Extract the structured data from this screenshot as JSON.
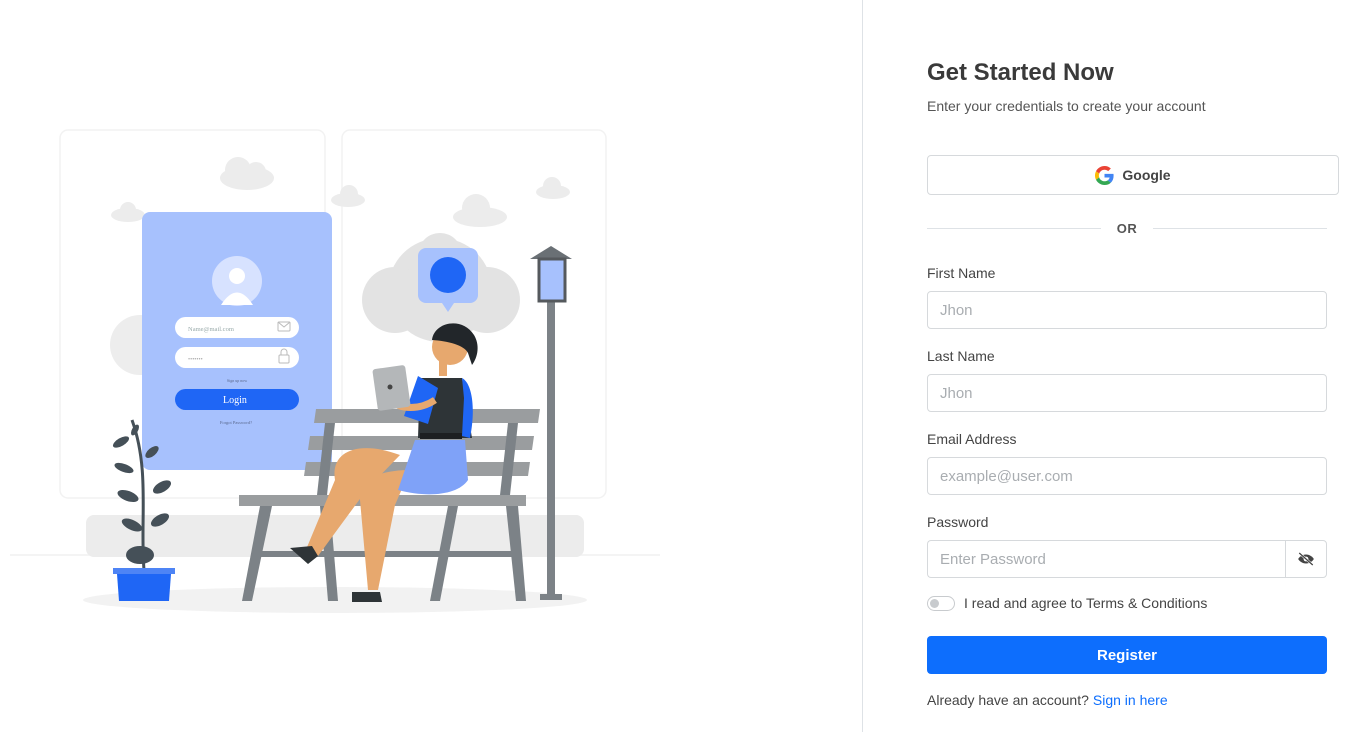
{
  "header": {
    "title": "Get Started Now",
    "subtitle": "Enter your credentials to create your account"
  },
  "social": {
    "google_label": "Google"
  },
  "divider": {
    "text": "OR"
  },
  "fields": {
    "first_name": {
      "label": "First Name",
      "placeholder": "Jhon"
    },
    "last_name": {
      "label": "Last Name",
      "placeholder": "Jhon"
    },
    "email": {
      "label": "Email Address",
      "placeholder": "example@user.com"
    },
    "password": {
      "label": "Password",
      "placeholder": "Enter Password"
    }
  },
  "terms": {
    "label": "I read and agree to Terms & Conditions",
    "checked": false
  },
  "register_label": "Register",
  "signin": {
    "prompt": "Already have an account?",
    "link": "Sign in here"
  },
  "illustration": {
    "card_email_placeholder": "Name@mail.com",
    "card_password_dots": "•••••••",
    "card_login_label": "Login",
    "card_small_text": "Sign up now",
    "card_forgot_text": "Forgot Password?"
  },
  "colors": {
    "accent": "#0d6efd",
    "illustration_blue": "#1f66f5",
    "illustration_light_blue": "#a7c1fd"
  }
}
